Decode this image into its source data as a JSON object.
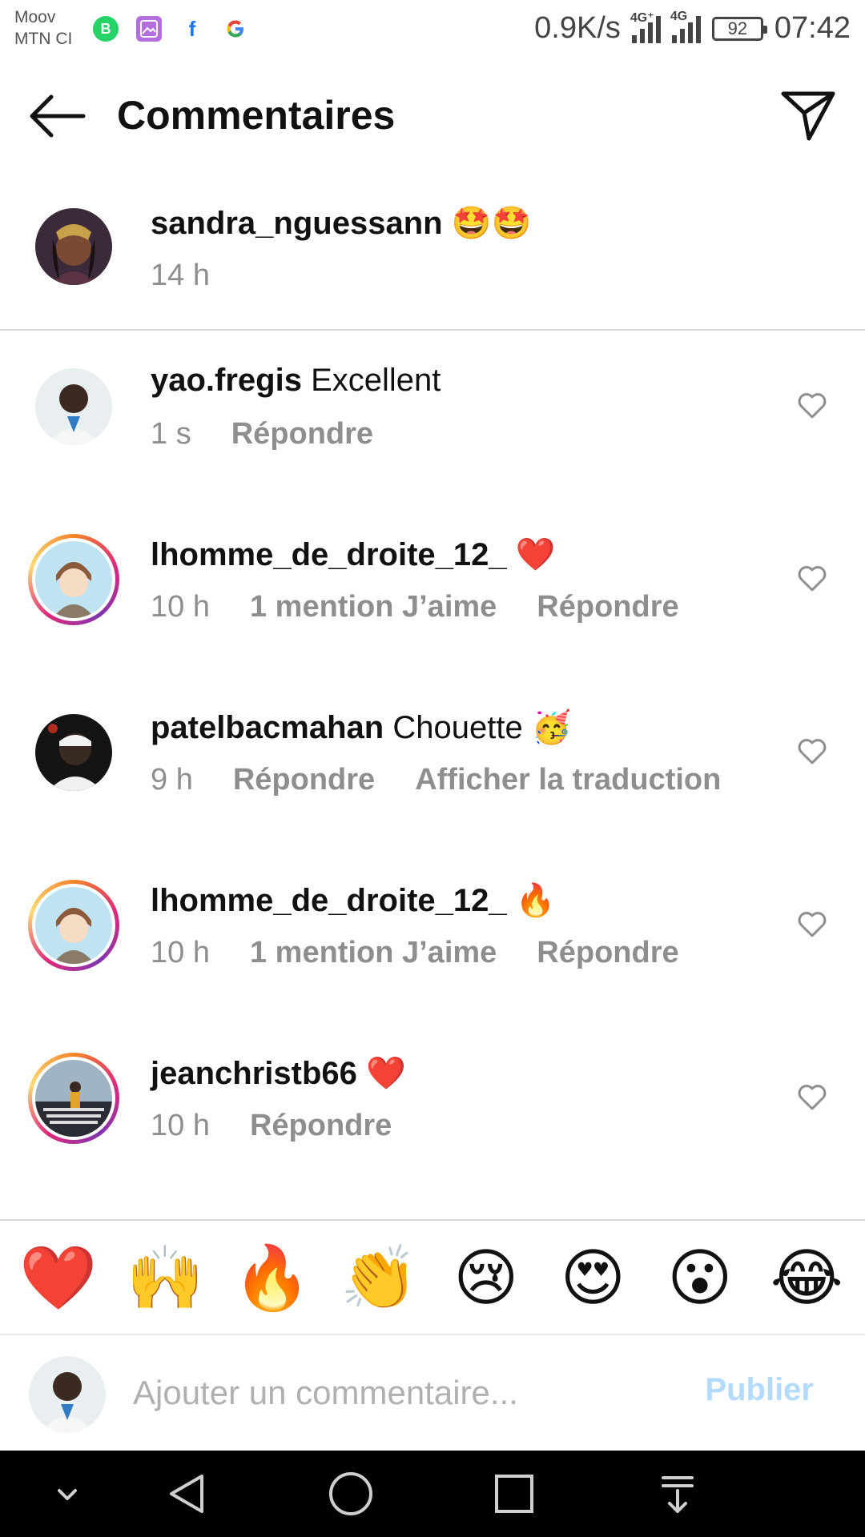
{
  "status_bar": {
    "carrier_1": "Moov",
    "carrier_2": "MTN CI",
    "app_icons": [
      "whatsapp-business-icon",
      "gallery-icon",
      "facebook-icon",
      "google-icon"
    ],
    "net_speed": "0.9K/s",
    "signal_1_tag": "4G⁺",
    "signal_2_tag": "4G",
    "battery": "92",
    "time": "07:42"
  },
  "header": {
    "title": "Commentaires"
  },
  "caption": {
    "username": "sandra_nguessann",
    "text": "🤩🤩",
    "time": "14 h"
  },
  "comments": [
    {
      "username": "yao.fregis",
      "text": "Excellent",
      "time": "1 s",
      "likes": "",
      "reply": "Répondre",
      "extra": ""
    },
    {
      "username": "lhomme_de_droite_12_",
      "text": "❤️",
      "time": "10 h",
      "likes": "1 mention J’aime",
      "reply": "Répondre",
      "extra": ""
    },
    {
      "username": "patelbacmahan",
      "text": "Chouette 🥳",
      "time": "9 h",
      "likes": "",
      "reply": "Répondre",
      "extra": "Afficher la traduction"
    },
    {
      "username": "lhomme_de_droite_12_",
      "text": "🔥",
      "time": "10 h",
      "likes": "1 mention J’aime",
      "reply": "Répondre",
      "extra": ""
    },
    {
      "username": "jeanchristb66",
      "text": "❤️",
      "time": "10 h",
      "likes": "",
      "reply": "Répondre",
      "extra": ""
    }
  ],
  "emoji_bar": [
    "❤️",
    "🙌",
    "🔥",
    "👏",
    "😢",
    "😍",
    "😮",
    "😂"
  ],
  "input": {
    "placeholder": "Ajouter un commentaire...",
    "publish_label": "Publier"
  },
  "colors": {
    "publish_disabled": "#b3dbff",
    "meta_gray": "#8e8e8e",
    "divider": "#dbdbdb"
  }
}
